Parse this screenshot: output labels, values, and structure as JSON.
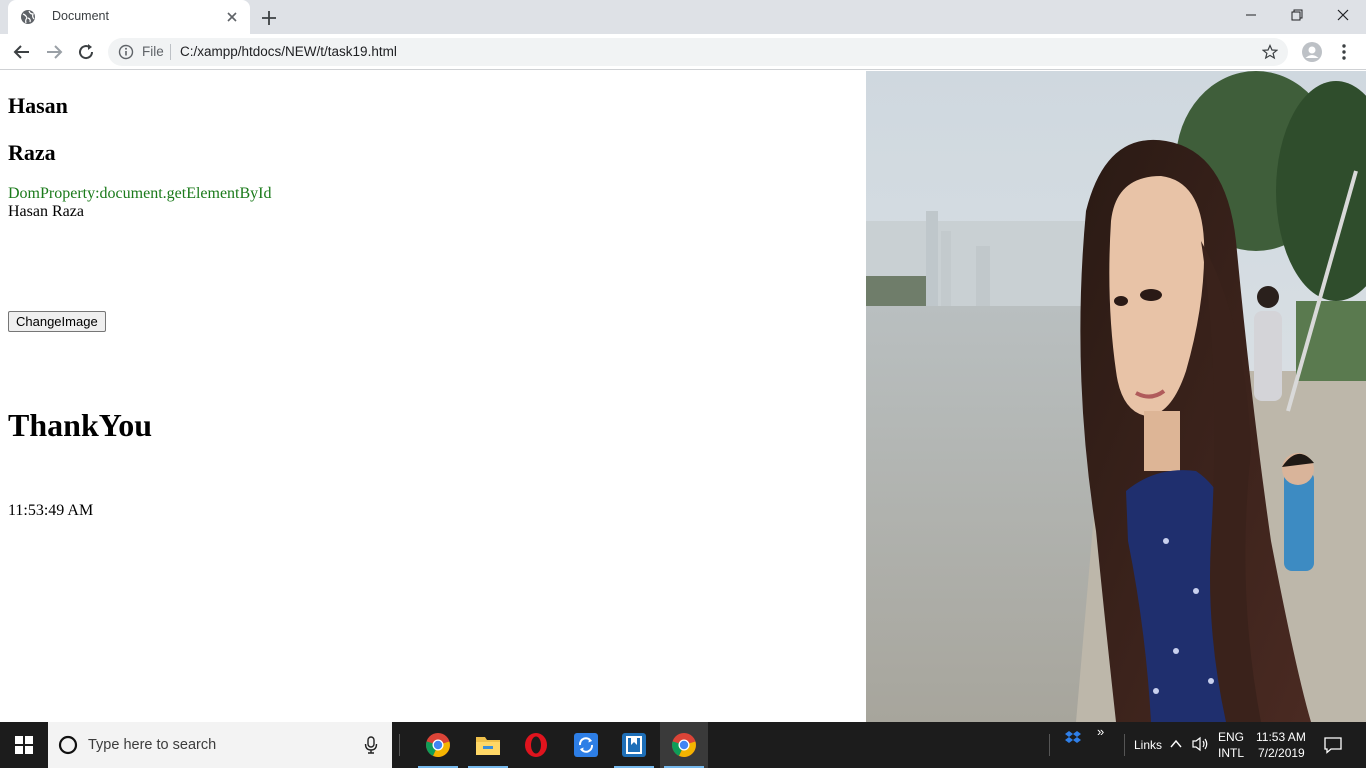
{
  "browser": {
    "tab_title": "Document",
    "omnibox_scheme": "File",
    "omnibox_url": "C:/xampp/htdocs/NEW/t/task19.html"
  },
  "page": {
    "first_heading": "Hasan",
    "last_heading": "Raza",
    "dom_property_label": "DomProperty:document.getElementById",
    "full_name": "Hasan Raza",
    "change_button_label": "ChangeImage",
    "thanks_heading": "ThankYou",
    "clock_time": "11:53:49 AM"
  },
  "taskbar": {
    "search_placeholder": "Type here to search",
    "links_label": "Links",
    "lang_line1": "ENG",
    "lang_line2": "INTL",
    "time": "11:53 AM",
    "date": "7/2/2019"
  },
  "colors": {
    "dom_label": "#1a7a1a",
    "tabstrip": "#dee1e6",
    "taskbar": "#1c1c1c",
    "taskbar_active_underline": "#76b9ed"
  }
}
